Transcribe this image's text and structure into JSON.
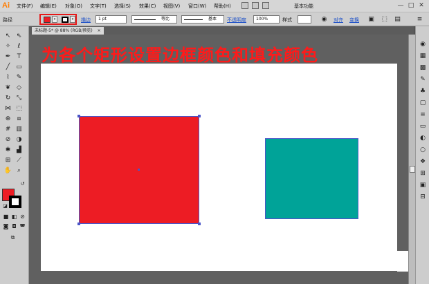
{
  "app": {
    "logo": "Ai"
  },
  "menu": {
    "items": [
      "文件(F)",
      "编辑(E)",
      "对象(O)",
      "文字(T)",
      "选择(S)",
      "效果(C)",
      "视图(V)",
      "窗口(W)",
      "帮助(H)"
    ],
    "workspace": "基本功能",
    "window_controls": [
      "—",
      "□",
      "✕"
    ]
  },
  "control_bar": {
    "object_type": "路径",
    "stroke_link": "描边",
    "stroke_weight": "1 pt",
    "profile_label": "等比",
    "brush_label": "基本",
    "opacity_link": "不透明度",
    "opacity_value": "100%",
    "style_label": "样式",
    "align_link": "对齐",
    "transform_link": "变换"
  },
  "document_tab": {
    "label": "未标题-5* @ 88% (RGB/预览)",
    "close": "×"
  },
  "headline": "为各个矩形设置边框颜色和填充颜色",
  "colors": {
    "fill": "#ED1C24",
    "stroke": "#000000",
    "rect_red": "#ED1C24",
    "rect_teal": "#00A398",
    "selection": "#4A55C8",
    "headline": "#FF1A1A"
  },
  "tools": [
    "selection-icon",
    "direct-selection-icon",
    "magic-wand-icon",
    "lasso-icon",
    "pen-icon",
    "type-icon",
    "line-icon",
    "rectangle-icon",
    "paintbrush-icon",
    "pencil-icon",
    "blob-brush-icon",
    "eraser-icon",
    "rotate-icon",
    "scale-icon",
    "width-icon",
    "free-transform-icon",
    "shape-builder-icon",
    "perspective-icon",
    "mesh-icon",
    "gradient-icon",
    "eyedropper-icon",
    "blend-icon",
    "symbol-sprayer-icon",
    "graph-icon",
    "artboard-icon",
    "slice-icon",
    "hand-icon",
    "zoom-icon"
  ],
  "panels": [
    "color-icon",
    "color-guide-icon",
    "swatches-icon",
    "brushes-icon",
    "symbols-icon",
    "graphic-styles-icon",
    "stroke-icon",
    "gradient-panel-icon",
    "transparency-icon",
    "appearance-icon",
    "layers-icon",
    "artboards-panel-icon"
  ]
}
